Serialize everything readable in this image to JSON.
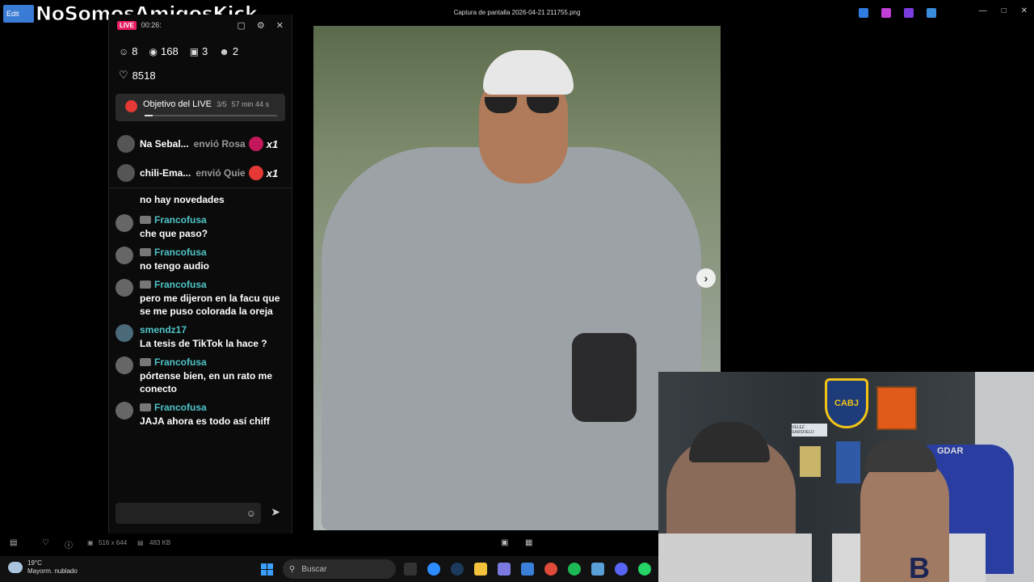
{
  "stream": {
    "channel_name": "NoSomosAmigosKick",
    "logo_text": "Edit"
  },
  "viewer": {
    "title": "Captura de pantalla 2026-04-21 211755.png",
    "dimensions": "516 x 644",
    "file_size": "483 KB"
  },
  "chat": {
    "live_label": "LIVE",
    "live_time": "00:26:",
    "stats": {
      "members": "8",
      "viewers": "168",
      "gifts": "3",
      "follows": "2"
    },
    "likes": "8518",
    "goal": {
      "label": "Objetivo del LIVE",
      "progress_text": "3/5",
      "time_left": "57 min 44 s",
      "progress": 0.06
    },
    "gift_events": [
      {
        "user": "Na Sebal...",
        "action": "envió Rosa",
        "count": "x1",
        "gift_color": "#c2185b"
      },
      {
        "user": "chili-Ema...",
        "action": "envió Quie",
        "count": "x1",
        "gift_color": "#e53935"
      }
    ],
    "messages": [
      {
        "user": "",
        "text": "no hay novedades"
      },
      {
        "user": "Francofusa",
        "text": "che que paso?"
      },
      {
        "user": "Francofusa",
        "text": "no tengo audio"
      },
      {
        "user": "Francofusa",
        "text": "pero me dijeron en la facu que se me puso colorada la oreja"
      },
      {
        "user": "smendz17",
        "text": "La tesis de TikTok la hace ?"
      },
      {
        "user": "Francofusa",
        "text": "pórtense bien, en un rato me conecto"
      },
      {
        "user": "Francofusa",
        "text": "JAJA ahora es todo así chiff"
      }
    ],
    "input_placeholder": ""
  },
  "webcam": {
    "shield_text": "CABJ",
    "plate_text": "VELEZ SARSFIELD",
    "chair_text": "GDAR",
    "shirt_letter": "B"
  },
  "taskbar": {
    "weather_temp": "19°C",
    "weather_desc": "Mayorm. nublado",
    "search_placeholder": "Buscar"
  },
  "colors": {
    "accent_live": "#e91e63",
    "username": "#4fc3c7",
    "boca_blue": "#1e3c7a",
    "boca_gold": "#f2c417"
  }
}
